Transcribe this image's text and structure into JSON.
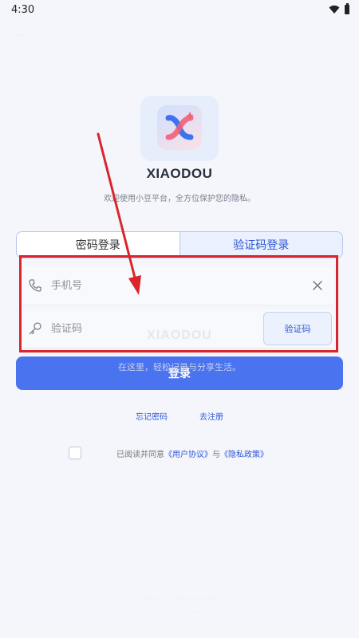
{
  "status_bar": {
    "time": "4:30"
  },
  "app": {
    "name": "XIAODOU",
    "tagline": "欢迎使用小豆平台，全方位保护您的隐私。"
  },
  "tabs": [
    {
      "label": "密码登录",
      "active": false
    },
    {
      "label": "验证码登录",
      "active": true
    }
  ],
  "form": {
    "phone_placeholder": "手机号",
    "code_placeholder": "验证码",
    "code_button": "验证码"
  },
  "watermark": {
    "word": "XIAODOU",
    "line": "在这里，轻松记录与分享生活。"
  },
  "login_button": "登录",
  "links": {
    "forgot_password": "忘记密码",
    "register": "去注册"
  },
  "agreement": {
    "prefix": "已阅读并同意",
    "user_agreement": "《用户协议》",
    "conjunction": "与",
    "privacy_policy": "《隐私政策》"
  },
  "colors": {
    "accent": "#4a73f0",
    "link": "#2e57d6",
    "annotation": "#d9262c"
  },
  "icons": [
    "wifi-icon",
    "battery-icon",
    "app-logo-icon",
    "phone-icon",
    "key-icon",
    "close-icon"
  ]
}
